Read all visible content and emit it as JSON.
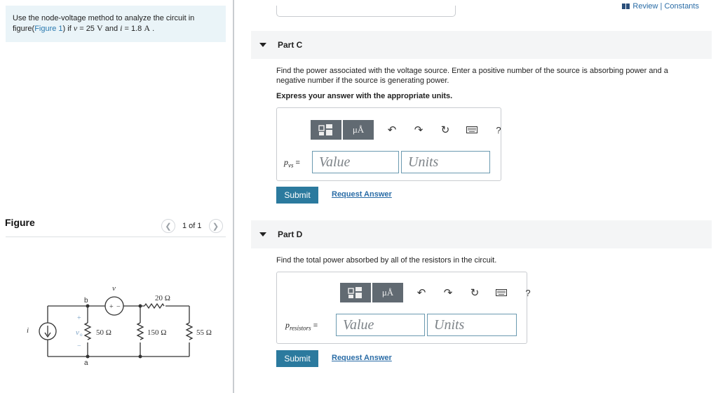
{
  "problem": {
    "text_before": "Use the node-voltage method to analyze the circuit in figure(",
    "figure_link": "Figure 1",
    "text_mid": ") if ",
    "v_var": "v",
    "v_eq": " = 25 ",
    "v_unit": "V",
    "and_text": " and ",
    "i_var": "i",
    "i_eq": " = 1.8 ",
    "i_unit": "A",
    "end": " ."
  },
  "figure": {
    "label": "Figure",
    "pager": "1 of 1",
    "prev_icon": "chevron-left-icon",
    "next_icon": "chevron-right-icon",
    "circuit_labels": {
      "node_b": "b",
      "node_a": "a",
      "source_v": "v",
      "source_i": "i",
      "vo_label": "v",
      "vo_sub": "o",
      "plus": "+",
      "minus": "−",
      "r20": "20 Ω",
      "r50": "50 Ω",
      "r150": "150 Ω",
      "r55": "55 Ω"
    }
  },
  "header": {
    "review_label": "Review | Constants"
  },
  "part_c": {
    "title": "Part C",
    "question": "Find the power associated with the voltage source.  Enter a positive number of the source is absorbing power and a negative number if the source is generating power.",
    "emphasis": "Express your answer with the appropriate units.",
    "var_main": "p",
    "var_sub": "vs",
    "equals": "=",
    "value_placeholder": "Value",
    "units_placeholder": "Units",
    "submit_label": "Submit",
    "request_label": "Request Answer"
  },
  "part_d": {
    "title": "Part D",
    "question": "Find the total power absorbed by all of the resistors in the circuit.",
    "var_main": "p",
    "var_sub": "resistors",
    "equals": "=",
    "value_placeholder": "Value",
    "units_placeholder": "Units",
    "submit_label": "Submit",
    "request_label": "Request Answer"
  },
  "toolbar": {
    "mu_label": "μÅ",
    "help_label": "?",
    "icons": [
      "templates-icon",
      "units-icon",
      "undo-icon",
      "redo-icon",
      "reset-icon",
      "keyboard-icon",
      "help-icon"
    ]
  },
  "colors": {
    "accent": "#2b7a9e",
    "link": "#2a6ca6",
    "problem_bg": "#eaf4f8",
    "toolbar_btn": "#616a72"
  }
}
